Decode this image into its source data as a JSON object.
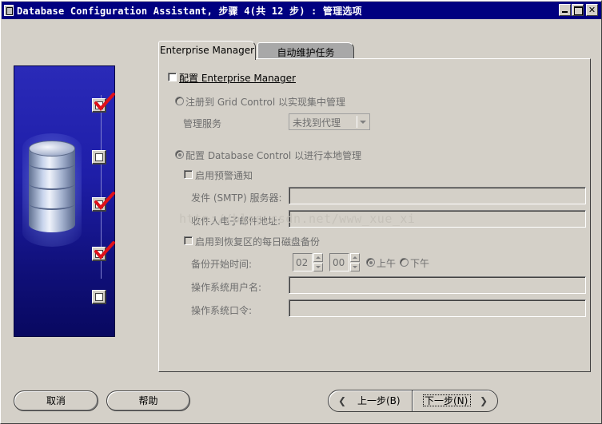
{
  "window": {
    "title": "Database Configuration Assistant, 步骤 4(共 12 步) : 管理选项"
  },
  "tabs": [
    {
      "label": "Enterprise Manager",
      "selected": true
    },
    {
      "label": "自动维护任务",
      "selected": false
    }
  ],
  "em": {
    "configure_label": "配置 Enterprise Manager",
    "configure_checked": false,
    "grid_radio_label": "注册到 Grid Control 以实现集中管理",
    "mgmt_service_label": "管理服务",
    "mgmt_service_value": "未找到代理",
    "db_control_radio_label": "配置 Database Control 以进行本地管理",
    "alerts_label": "启用预警通知",
    "smtp_label": "发件 (SMTP) 服务器:",
    "smtp_value": "",
    "email_label": "收件人电子邮件地址:",
    "email_value": "",
    "backup_label": "启用到恢复区的每日磁盘备份",
    "backup_time_label": "备份开始时间:",
    "backup_hour": "02",
    "backup_minute": "00",
    "am_label": "上午",
    "pm_label": "下午",
    "os_user_label": "操作系统用户名:",
    "os_user_value": "",
    "os_password_label": "操作系统口令:",
    "os_password_value": ""
  },
  "watermark": "http://blog.csdn.net/www_xue_xi",
  "buttons": {
    "cancel": "取消",
    "help": "帮助",
    "back": "上一步(B)",
    "next": "下一步(N)"
  },
  "art": {
    "steps": [
      {
        "checked": true
      },
      {
        "checked": false
      },
      {
        "checked": true
      },
      {
        "checked": true
      },
      {
        "checked": false
      }
    ]
  },
  "colors": {
    "titlebar": "#000080",
    "face": "#d4d0c8",
    "check_mark": "#e0101a",
    "art_panel": "#1e1ea8"
  }
}
